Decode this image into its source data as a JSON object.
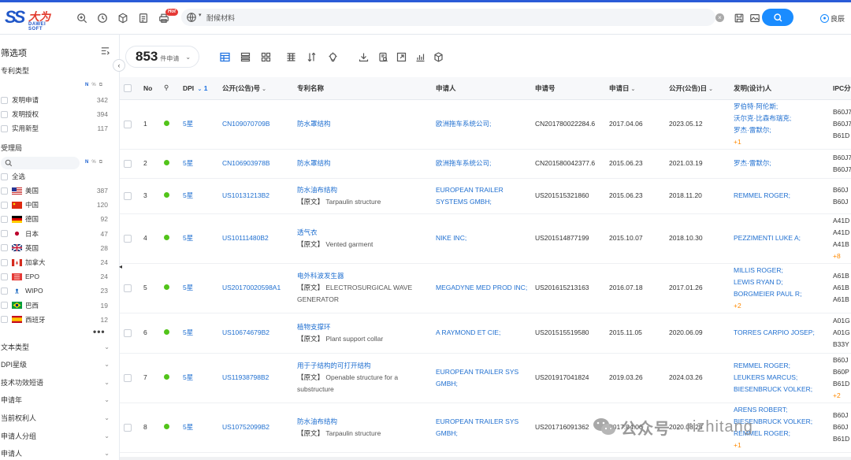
{
  "header": {
    "logo_cn": "大为",
    "logo_en": "DAWEI SOFT",
    "hot_badge": "Hot",
    "search_value": "耐候材料",
    "user_name": "良辰"
  },
  "sidebar": {
    "title": "筛选项",
    "patent_type": {
      "title": "专利类型",
      "tools": [
        "N",
        "%"
      ],
      "items": [
        {
          "label": "发明申请",
          "count": "342"
        },
        {
          "label": "发明授权",
          "count": "394"
        },
        {
          "label": "实用新型",
          "count": "117"
        }
      ]
    },
    "office": {
      "title": "受理局",
      "tools": [
        "N",
        "%"
      ],
      "search_placeholder": "",
      "select_all": "全选",
      "items": [
        {
          "label": "美国",
          "count": "387",
          "flag": "us"
        },
        {
          "label": "中国",
          "count": "120",
          "flag": "cn"
        },
        {
          "label": "德国",
          "count": "92",
          "flag": "de"
        },
        {
          "label": "日本",
          "count": "47",
          "flag": "jp"
        },
        {
          "label": "英国",
          "count": "28",
          "flag": "gb"
        },
        {
          "label": "加拿大",
          "count": "24",
          "flag": "ca"
        },
        {
          "label": "EPO",
          "count": "24",
          "flag": "epo"
        },
        {
          "label": "WIPO",
          "count": "23",
          "flag": "wipo"
        },
        {
          "label": "巴西",
          "count": "19",
          "flag": "br"
        },
        {
          "label": "西班牙",
          "count": "12",
          "flag": "es"
        }
      ],
      "more": "•••"
    },
    "groups": [
      "文本类型",
      "DPI星级",
      "技术功效短语",
      "申请年",
      "当前权利人",
      "申请人分组",
      "申请人"
    ]
  },
  "toolbar": {
    "count": "853",
    "count_unit": "件申请"
  },
  "table": {
    "headers": {
      "no": "No",
      "dpi": "DPI",
      "dpi_sort": "1",
      "pub_no": "公开(公告)号",
      "title": "专利名称",
      "applicant": "申请人",
      "app_no": "申请号",
      "app_date": "申请日",
      "pub_date": "公开(公告)日",
      "inventor": "发明(设计)人",
      "ipc": "IPC分"
    },
    "original_tag": "【原文】",
    "rows": [
      {
        "no": "1",
        "dpi": "5星",
        "pub_no": "CN109070709B",
        "title": "防水罩结构",
        "orig": "",
        "applicant": "欧洲拖车系统公司;",
        "app_no": "CN201780022284.6",
        "app_date": "2017.04.06",
        "pub_date": "2023.05.12",
        "inventors": [
          "罗伯特·阿伦斯;",
          "沃尔克·比森布瑞克;",
          "罗杰·雷默尔;"
        ],
        "inv_more": "+1",
        "ipc": [
          "B60J7",
          "B60J7",
          "B61D"
        ],
        "ipc_more": ""
      },
      {
        "no": "2",
        "dpi": "5星",
        "pub_no": "CN106903978B",
        "title": "防水罩结构",
        "orig": "",
        "applicant": "欧洲拖车系统公司;",
        "app_no": "CN201580042377.6",
        "app_date": "2015.06.23",
        "pub_date": "2021.03.19",
        "inventors": [
          "罗杰·雷默尔;"
        ],
        "inv_more": "",
        "ipc": [
          "B60J7",
          "B60J7"
        ],
        "ipc_more": ""
      },
      {
        "no": "3",
        "dpi": "5星",
        "pub_no": "US10131213B2",
        "title": "防水油布结构",
        "orig": "Tarpaulin structure",
        "applicant": "EUROPEAN TRAILER SYSTEMS GMBH;",
        "app_no": "US201515321860",
        "app_date": "2015.06.23",
        "pub_date": "2018.11.20",
        "inventors": [
          "REMMEL ROGER;"
        ],
        "inv_more": "",
        "ipc": [
          "B60J",
          "B60J"
        ],
        "ipc_more": ""
      },
      {
        "no": "4",
        "dpi": "5星",
        "pub_no": "US10111480B2",
        "title": "透气衣",
        "orig": "Vented garment",
        "applicant": "NIKE INC;",
        "app_no": "US201514877199",
        "app_date": "2015.10.07",
        "pub_date": "2018.10.30",
        "inventors": [
          "PEZZIMENTI LUKE A;"
        ],
        "inv_more": "",
        "ipc": [
          "A41D",
          "A41D",
          "A41B"
        ],
        "ipc_more": "+8"
      },
      {
        "no": "5",
        "dpi": "5星",
        "pub_no": "US20170020598A1",
        "title": "电外科波发生器",
        "orig": "ELECTROSURGICAL WAVE GENERATOR",
        "applicant": "MEGADYNE MED PROD INC;",
        "app_no": "US201615213163",
        "app_date": "2016.07.18",
        "pub_date": "2017.01.26",
        "inventors": [
          "MILLIS ROGER;",
          "LEWIS RYAN D;",
          "BORGMEIER PAUL R;"
        ],
        "inv_more": "+2",
        "ipc": [
          "A61B",
          "A61B",
          "A61B"
        ],
        "ipc_more": ""
      },
      {
        "no": "6",
        "dpi": "5星",
        "pub_no": "US10674679B2",
        "title": "植物支撑环",
        "orig": "Plant support collar",
        "applicant": "A RAYMOND ET CIE;",
        "app_no": "US201515519580",
        "app_date": "2015.11.05",
        "pub_date": "2020.06.09",
        "inventors": [
          "TORRES CARPIO JOSEP;"
        ],
        "inv_more": "",
        "ipc": [
          "A01G",
          "A01G",
          "B33Y"
        ],
        "ipc_more": ""
      },
      {
        "no": "7",
        "dpi": "5星",
        "pub_no": "US11938798B2",
        "title": "用于子结构的可打开结构",
        "orig": "Openable structure for a substructure",
        "applicant": "EUROPEAN TRAILER SYS GMBH;",
        "app_no": "US201917041824",
        "app_date": "2019.03.26",
        "pub_date": "2024.03.26",
        "inventors": [
          "REMMEL ROGER;",
          "LEUKERS MARCUS;",
          "BIESENBRUCK VOLKER;"
        ],
        "inv_more": "",
        "ipc": [
          "B60J",
          "B60P",
          "B61D"
        ],
        "ipc_more": "+2"
      },
      {
        "no": "8",
        "dpi": "5星",
        "pub_no": "US10752099B2",
        "title": "防水油布结构",
        "orig": "Tarpaulin structure",
        "applicant": "EUROPEAN TRAILER SYS GMBH;",
        "app_no": "US201716091362",
        "app_date": "2017.04.06",
        "pub_date": "2020.08.25",
        "inventors": [
          "ARENS ROBERT;",
          "BIESENBRUCK VOLKER;",
          "REMMEL ROGER;"
        ],
        "inv_more": "+1",
        "ipc": [
          "B60J",
          "B60J",
          "B61D"
        ],
        "ipc_more": ""
      }
    ]
  },
  "watermark": {
    "text_cn": "公众号 ·",
    "text_en": "rizhitang"
  },
  "colors": {
    "accent": "#1a8cff",
    "link": "#1f6fd0",
    "status_green": "#52c41a",
    "more_orange": "#ff8a00"
  }
}
